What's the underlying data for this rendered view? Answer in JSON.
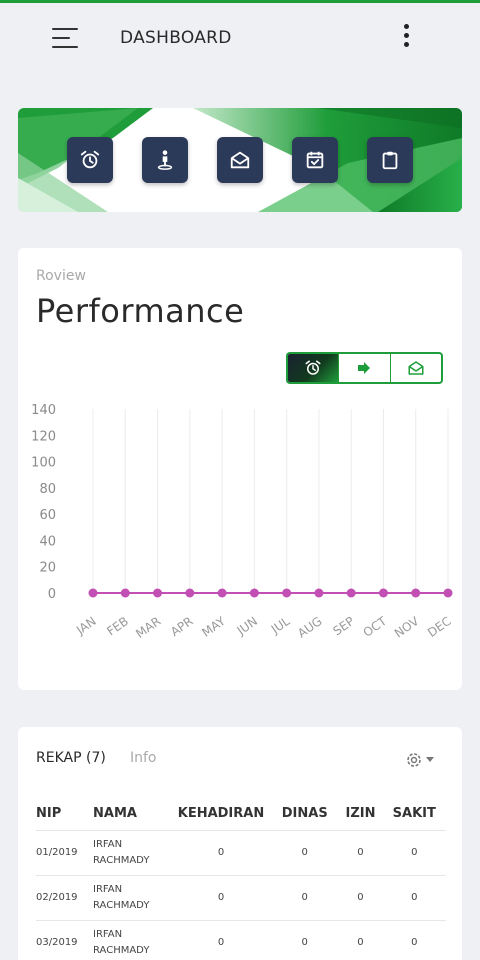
{
  "header": {
    "title": "DASHBOARD"
  },
  "banner": {
    "icons": [
      "alarm-clock-icon",
      "person-location-icon",
      "envelope-open-icon",
      "calendar-check-icon",
      "clipboard-icon"
    ]
  },
  "performance": {
    "subtitle": "Roview",
    "title": "Performance",
    "toggle_icons": [
      "alarm-clock-icon",
      "sign-out-icon",
      "envelope-open-icon"
    ],
    "active_toggle": 0
  },
  "chart_data": {
    "type": "line",
    "categories": [
      "JAN",
      "FEB",
      "MAR",
      "APR",
      "MAY",
      "JUN",
      "JUL",
      "AUG",
      "SEP",
      "OCT",
      "NOV",
      "DEC"
    ],
    "series": [
      {
        "values": [
          0,
          0,
          0,
          0,
          0,
          0,
          0,
          0,
          0,
          0,
          0,
          0
        ]
      }
    ],
    "yticks": [
      "140",
      "120",
      "100",
      "80",
      "60",
      "40",
      "20",
      "0"
    ],
    "ylim": [
      0,
      140
    ],
    "colors": {
      "series": "#c24fb4",
      "grid": "#ececec"
    }
  },
  "rekap": {
    "tab_label": "REKAP (7)",
    "info_label": "Info",
    "columns": [
      "NIP",
      "NAMA",
      "KEHADIRAN",
      "DINAS",
      "IZIN",
      "SAKIT"
    ],
    "rows": [
      {
        "nip": "01/2019",
        "nama1": "IRFAN",
        "nama2": "RACHMADY",
        "kehadiran": "0",
        "dinas": "0",
        "izin": "0",
        "sakit": "0"
      },
      {
        "nip": "02/2019",
        "nama1": "IRFAN",
        "nama2": "RACHMADY",
        "kehadiran": "0",
        "dinas": "0",
        "izin": "0",
        "sakit": "0"
      },
      {
        "nip": "03/2019",
        "nama1": "IRFAN",
        "nama2": "RACHMADY",
        "kehadiran": "0",
        "dinas": "0",
        "izin": "0",
        "sakit": "0"
      }
    ]
  },
  "colors": {
    "accent": "#1f9d3a",
    "dark_button": "#2c3a5a"
  }
}
